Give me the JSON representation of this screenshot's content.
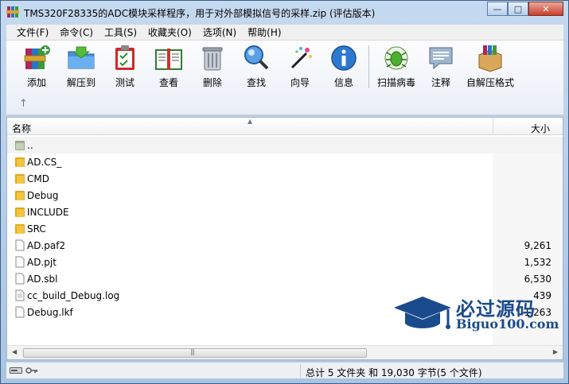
{
  "window": {
    "title": "TMS320F28335的ADC模块采样程序，用于对外部模拟信号的采样.zip (评估版本)",
    "controls": {
      "minimize": "—",
      "maximize": "□",
      "close": "✕"
    }
  },
  "menu": [
    {
      "label": "文件(F)"
    },
    {
      "label": "命令(C)"
    },
    {
      "label": "工具(S)"
    },
    {
      "label": "收藏夹(O)"
    },
    {
      "label": "选项(N)"
    },
    {
      "label": "帮助(H)"
    }
  ],
  "toolbar": [
    {
      "label": "添加",
      "icon": "add-archive-icon"
    },
    {
      "label": "解压到",
      "icon": "extract-folder-icon"
    },
    {
      "label": "测试",
      "icon": "test-clipboard-icon"
    },
    {
      "label": "查看",
      "icon": "view-book-icon"
    },
    {
      "label": "删除",
      "icon": "trash-icon"
    },
    {
      "label": "查找",
      "icon": "magnifier-icon"
    },
    {
      "label": "向导",
      "icon": "wizard-wand-icon"
    },
    {
      "label": "信息",
      "icon": "info-icon"
    },
    {
      "label": "扫描病毒",
      "icon": "virus-scan-icon"
    },
    {
      "label": "注释",
      "icon": "comment-icon"
    },
    {
      "label": "自解压格式",
      "icon": "sfx-box-icon"
    }
  ],
  "nav": {
    "up_arrow": "↑"
  },
  "columns": {
    "name": "名称",
    "size": "大小",
    "sort_indicator": "▲"
  },
  "files": [
    {
      "name": "..",
      "type": "parent",
      "size": ""
    },
    {
      "name": "AD.CS_",
      "type": "folder",
      "size": ""
    },
    {
      "name": "CMD",
      "type": "folder",
      "size": ""
    },
    {
      "name": "Debug",
      "type": "folder",
      "size": ""
    },
    {
      "name": "INCLUDE",
      "type": "folder",
      "size": ""
    },
    {
      "name": "SRC",
      "type": "folder",
      "size": ""
    },
    {
      "name": "AD.paf2",
      "type": "file",
      "size": "9,261"
    },
    {
      "name": "AD.pjt",
      "type": "file",
      "size": "1,532"
    },
    {
      "name": "AD.sbl",
      "type": "file",
      "size": "6,530"
    },
    {
      "name": "cc_build_Debug.log",
      "type": "file",
      "size": "439"
    },
    {
      "name": "Debug.lkf",
      "type": "file",
      "size": "1,263"
    }
  ],
  "scrollbar": {
    "grip": "|||",
    "left": "◀",
    "right": "▶"
  },
  "status": {
    "summary": "总计 5 文件夹 和 19,030 字节(5 个文件)"
  },
  "watermark": {
    "brand": "必过源码",
    "url": "Biguo100.com"
  },
  "colors": {
    "folder": "#f4c542",
    "brand": "#1a4b8c"
  }
}
